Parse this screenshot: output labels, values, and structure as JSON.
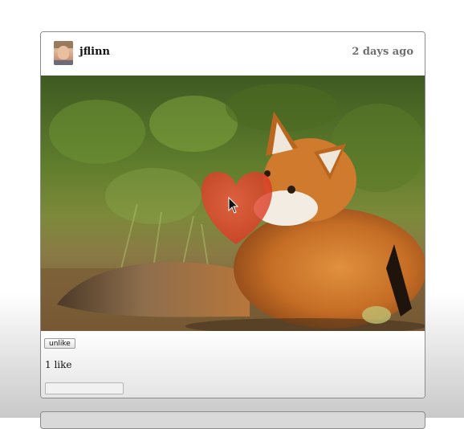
{
  "post": {
    "username": "jflinn",
    "timestamp": "2 days ago",
    "unlike_label": "unlike",
    "likes_text": "1 like",
    "comment_placeholder": ""
  },
  "icons": {
    "avatar": "user-avatar",
    "like_overlay": "heart-icon",
    "cursor": "mouse-pointer-icon"
  },
  "colors": {
    "heart": "#e2452f",
    "fox_fur": "#c9712a"
  }
}
